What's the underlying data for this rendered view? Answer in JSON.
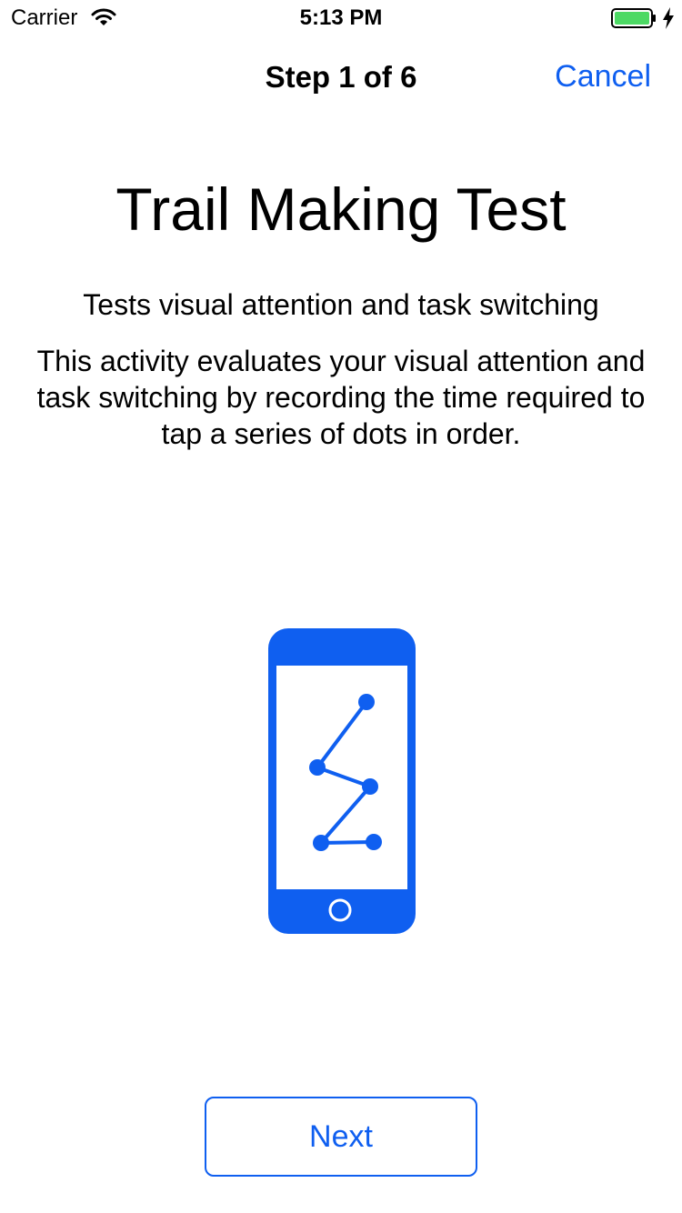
{
  "status_bar": {
    "carrier": "Carrier",
    "time": "5:13 PM",
    "icons": [
      "wifi-icon",
      "battery-icon",
      "charging-icon"
    ],
    "battery_color": "#4cd964"
  },
  "nav": {
    "title": "Step 1 of 6",
    "cancel_label": "Cancel"
  },
  "content": {
    "title": "Trail Making Test",
    "subtitle": "Tests visual attention and task switching",
    "description": "This activity evaluates your visual attention and task switching by recording the time required to tap a series of dots in order.",
    "illustration_icon": "phone-trail-illustration-icon"
  },
  "footer": {
    "next_label": "Next"
  },
  "colors": {
    "accent": "#0f5ff0",
    "text": "#000000",
    "background": "#ffffff"
  }
}
